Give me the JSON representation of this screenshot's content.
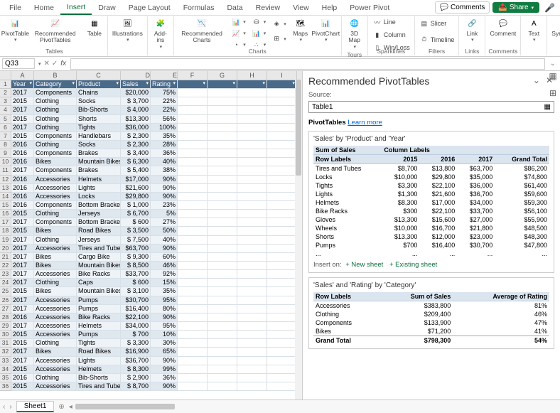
{
  "tabs": [
    "File",
    "Home",
    "Insert",
    "Draw",
    "Page Layout",
    "Formulas",
    "Data",
    "Review",
    "View",
    "Help",
    "Power Pivot"
  ],
  "activeTab": "Insert",
  "comments_btn": "Comments",
  "share_btn": "Share",
  "ribbon": {
    "tables": {
      "pivot": "PivotTable",
      "recpivot": "Recommended\nPivotTables",
      "table": "Table",
      "label": "Tables"
    },
    "ill": {
      "ill": "Illustrations"
    },
    "addins": {
      "addins": "Add-\nins"
    },
    "charts": {
      "rec": "Recommended\nCharts",
      "maps": "Maps",
      "pivotchart": "PivotChart",
      "label": "Charts"
    },
    "tours": {
      "map": "3D\nMap",
      "label": "Tours"
    },
    "spark": {
      "line": "Line",
      "col": "Column",
      "wl": "Win/Loss",
      "label": "Sparklines"
    },
    "filters": {
      "slicer": "Slicer",
      "timeline": "Timeline",
      "label": "Filters"
    },
    "links": {
      "link": "Link",
      "label": "Links"
    },
    "comments": {
      "comment": "Comment",
      "label": "Comments"
    },
    "text": {
      "text": "Text"
    },
    "symbols": {
      "symbols": "Symbols"
    }
  },
  "namebox": "Q33",
  "colheads": [
    "A",
    "B",
    "C",
    "D",
    "E",
    "F",
    "G",
    "H",
    "I"
  ],
  "headers": [
    "Year",
    "Category",
    "Product",
    "Sales",
    "Rating"
  ],
  "rows": [
    [
      "2017",
      "Components",
      "Chains",
      "$20,000",
      "75%"
    ],
    [
      "2015",
      "Clothing",
      "Socks",
      "$ 3,700",
      "22%"
    ],
    [
      "2017",
      "Clothing",
      "Bib-Shorts",
      "$ 4,000",
      "22%"
    ],
    [
      "2015",
      "Clothing",
      "Shorts",
      "$13,300",
      "56%"
    ],
    [
      "2017",
      "Clothing",
      "Tights",
      "$36,000",
      "100%"
    ],
    [
      "2015",
      "Components",
      "Handlebars",
      "$ 2,300",
      "35%"
    ],
    [
      "2016",
      "Clothing",
      "Socks",
      "$ 2,300",
      "28%"
    ],
    [
      "2016",
      "Components",
      "Brakes",
      "$ 3,400",
      "36%"
    ],
    [
      "2016",
      "Bikes",
      "Mountain Bikes",
      "$ 6,300",
      "40%"
    ],
    [
      "2017",
      "Components",
      "Brakes",
      "$ 5,400",
      "38%"
    ],
    [
      "2016",
      "Accessories",
      "Helmets",
      "$17,000",
      "90%"
    ],
    [
      "2016",
      "Accessories",
      "Lights",
      "$21,600",
      "90%"
    ],
    [
      "2016",
      "Accessories",
      "Locks",
      "$29,800",
      "90%"
    ],
    [
      "2016",
      "Components",
      "Bottom Brackets",
      "$ 1,000",
      "23%"
    ],
    [
      "2015",
      "Clothing",
      "Jerseys",
      "$ 6,700",
      "5%"
    ],
    [
      "2017",
      "Components",
      "Bottom Brackets",
      "$ 600",
      "27%"
    ],
    [
      "2015",
      "Bikes",
      "Road Bikes",
      "$ 3,500",
      "50%"
    ],
    [
      "2017",
      "Clothing",
      "Jerseys",
      "$ 7,500",
      "40%"
    ],
    [
      "2017",
      "Accessories",
      "Tires and Tubes",
      "$63,700",
      "90%"
    ],
    [
      "2017",
      "Bikes",
      "Cargo Bike",
      "$ 9,300",
      "60%"
    ],
    [
      "2017",
      "Bikes",
      "Mountain Bikes",
      "$ 8,500",
      "46%"
    ],
    [
      "2017",
      "Accessories",
      "Bike Racks",
      "$33,700",
      "92%"
    ],
    [
      "2017",
      "Clothing",
      "Caps",
      "$ 600",
      "15%"
    ],
    [
      "2015",
      "Bikes",
      "Mountain Bikes",
      "$ 3,100",
      "35%"
    ],
    [
      "2017",
      "Accessories",
      "Pumps",
      "$30,700",
      "95%"
    ],
    [
      "2017",
      "Accessories",
      "Pumps",
      "$16,400",
      "80%"
    ],
    [
      "2016",
      "Accessories",
      "Bike Racks",
      "$22,100",
      "90%"
    ],
    [
      "2017",
      "Accessories",
      "Helmets",
      "$34,000",
      "95%"
    ],
    [
      "2015",
      "Accessories",
      "Pumps",
      "$ 700",
      "10%"
    ],
    [
      "2015",
      "Clothing",
      "Tights",
      "$ 3,300",
      "30%"
    ],
    [
      "2017",
      "Bikes",
      "Road Bikes",
      "$16,900",
      "65%"
    ],
    [
      "2017",
      "Accessories",
      "Lights",
      "$36,700",
      "90%"
    ],
    [
      "2015",
      "Accessories",
      "Helmets",
      "$ 8,300",
      "99%"
    ],
    [
      "2016",
      "Clothing",
      "Bib-Shorts",
      "$ 2,900",
      "36%"
    ],
    [
      "2015",
      "Accessories",
      "Tires and Tubes",
      "$ 8,700",
      "90%"
    ]
  ],
  "sheettab": "Sheet1",
  "pane": {
    "title": "Recommended PivotTables",
    "source_lbl": "Source:",
    "source_val": "Table1",
    "pt_lbl": "PivotTables",
    "learn": "Learn more",
    "card1": {
      "title": "'Sales' by 'Product' and 'Year'",
      "h1": "Sum of Sales",
      "h2": "Column Labels",
      "rowlbl": "Row Labels",
      "c1": "2015",
      "c2": "2016",
      "c3": "2017",
      "gt": "Grand Total",
      "rows": [
        [
          "Tires and Tubes",
          "$8,700",
          "$13,800",
          "$63,700",
          "$86,200"
        ],
        [
          "Locks",
          "$10,000",
          "$29,800",
          "$35,000",
          "$74,800"
        ],
        [
          "Tights",
          "$3,300",
          "$22,100",
          "$36,000",
          "$61,400"
        ],
        [
          "Lights",
          "$1,300",
          "$21,600",
          "$36,700",
          "$59,600"
        ],
        [
          "Helmets",
          "$8,300",
          "$17,000",
          "$34,000",
          "$59,300"
        ],
        [
          "Bike Racks",
          "$300",
          "$22,100",
          "$33,700",
          "$56,100"
        ],
        [
          "Gloves",
          "$13,300",
          "$15,600",
          "$27,000",
          "$55,900"
        ],
        [
          "Wheels",
          "$10,000",
          "$16,700",
          "$21,800",
          "$48,500"
        ],
        [
          "Shorts",
          "$13,300",
          "$12,000",
          "$23,000",
          "$48,300"
        ],
        [
          "Pumps",
          "$700",
          "$16,400",
          "$30,700",
          "$47,800"
        ],
        [
          "...",
          "...",
          "...",
          "...",
          "..."
        ]
      ],
      "insert": "Insert on:",
      "new": "+ New sheet",
      "exist": "+ Existing sheet"
    },
    "card2": {
      "title": "'Sales' and 'Rating' by 'Category'",
      "rowlbl": "Row Labels",
      "c1": "Sum of Sales",
      "c2": "Average of Rating",
      "rows": [
        [
          "Accessories",
          "$383,800",
          "81%"
        ],
        [
          "Clothing",
          "$209,400",
          "46%"
        ],
        [
          "Components",
          "$133,900",
          "47%"
        ],
        [
          "Bikes",
          "$71,200",
          "41%"
        ]
      ],
      "gtlbl": "Grand Total",
      "gt1": "$798,300",
      "gt2": "54%"
    }
  }
}
